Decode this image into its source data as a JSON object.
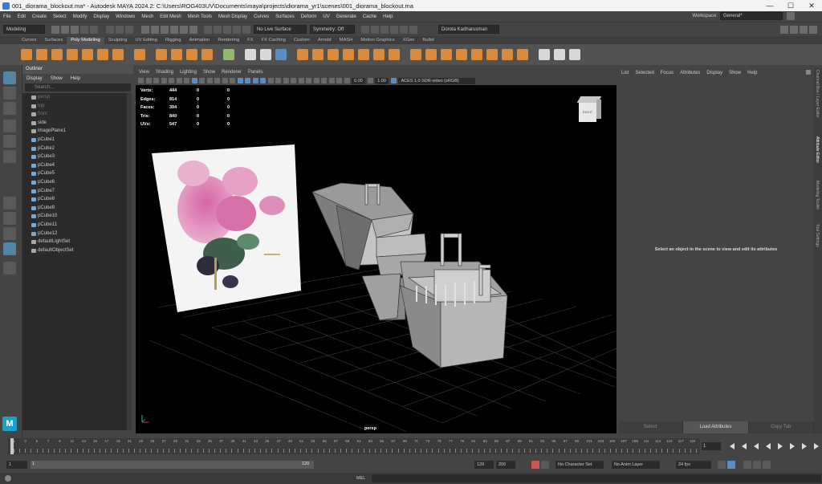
{
  "window": {
    "title": "001_diorama_blockout.ma* - Autodesk MAYA 2024.2: C:\\Users\\ROG403UV\\Documents\\maya\\projects\\diorama_yr1\\scenes\\001_diorama_blockout.ma",
    "minimize": "—",
    "maximize": "☐",
    "close": "✕"
  },
  "menubar": {
    "items": [
      "File",
      "Edit",
      "Create",
      "Select",
      "Modify",
      "Display",
      "Windows",
      "Mesh",
      "Edit Mesh",
      "Mesh Tools",
      "Mesh Display",
      "Curves",
      "Surfaces",
      "Deform",
      "UV",
      "Generate",
      "Cache",
      "Help"
    ],
    "workspace_label": "Workspace:",
    "workspace_value": "General*"
  },
  "statusline": {
    "menuset": "Modeling",
    "live_surface": "No Live Surface",
    "symmetry": "Symmetry: Off",
    "user": "Dorota Kadharusman"
  },
  "shelf_tabs": [
    "Curves",
    "Surfaces",
    "Poly Modeling",
    "Sculpting",
    "UV Editing",
    "Rigging",
    "Animation",
    "Rendering",
    "FX",
    "FX Caching",
    "Custom",
    "Arnold",
    "MASH",
    "Motion Graphics",
    "XGen",
    "Bullet"
  ],
  "shelf_active": "Poly Modeling",
  "outliner": {
    "title": "Outliner",
    "menu": [
      "Display",
      "Show",
      "Help"
    ],
    "search_placeholder": "Search...",
    "items": [
      {
        "label": "persp",
        "dim": true,
        "type": "cam"
      },
      {
        "label": "top",
        "dim": true,
        "type": "cam"
      },
      {
        "label": "front",
        "dim": true,
        "type": "cam"
      },
      {
        "label": "side",
        "dim": false,
        "type": "cam"
      },
      {
        "label": "imagePlane1",
        "dim": false,
        "type": "img"
      },
      {
        "label": "pCube1",
        "dim": false,
        "type": "cube"
      },
      {
        "label": "pCube2",
        "dim": false,
        "type": "cube"
      },
      {
        "label": "pCube3",
        "dim": false,
        "type": "cube"
      },
      {
        "label": "pCube4",
        "dim": false,
        "type": "cube"
      },
      {
        "label": "pCube5",
        "dim": false,
        "type": "cube"
      },
      {
        "label": "pCube6",
        "dim": false,
        "type": "cube"
      },
      {
        "label": "pCube7",
        "dim": false,
        "type": "cube"
      },
      {
        "label": "pCube8",
        "dim": false,
        "type": "cube"
      },
      {
        "label": "pCube9",
        "dim": false,
        "type": "cube"
      },
      {
        "label": "pCube10",
        "dim": false,
        "type": "cube"
      },
      {
        "label": "pCube11",
        "dim": false,
        "type": "cube"
      },
      {
        "label": "pCube12",
        "dim": false,
        "type": "cube"
      },
      {
        "label": "defaultLightSet",
        "dim": false,
        "type": "set"
      },
      {
        "label": "defaultObjectSet",
        "dim": false,
        "type": "set"
      }
    ]
  },
  "viewport": {
    "menu": [
      "View",
      "Shading",
      "Lighting",
      "Show",
      "Renderer",
      "Panels"
    ],
    "exposure": "0.00",
    "gamma": "1.00",
    "colorspace": "ACES 1.0 SDR-video (sRGB)",
    "hud": [
      {
        "label": "Verts:",
        "v1": "444",
        "v2": "0",
        "v3": "0"
      },
      {
        "label": "Edges:",
        "v1": "814",
        "v2": "0",
        "v3": "0"
      },
      {
        "label": "Faces:",
        "v1": "394",
        "v2": "0",
        "v3": "0"
      },
      {
        "label": "Tris:",
        "v1": "840",
        "v2": "0",
        "v3": "0"
      },
      {
        "label": "UVs:",
        "v1": "547",
        "v2": "0",
        "v3": "0"
      }
    ],
    "viewcube": "RIGHT",
    "camera": "persp"
  },
  "attribute_editor": {
    "menu": [
      "List",
      "Selected",
      "Focus",
      "Attributes",
      "Display",
      "Show",
      "Help"
    ],
    "message": "Select an object in the scene to view and edit its attributes",
    "buttons": [
      "Select",
      "Load Attributes",
      "Copy Tab"
    ],
    "side_tabs": [
      "Channel Box / Layer Editor",
      "Attribute Editor",
      "Modeling Toolkit",
      "Tool Settings"
    ]
  },
  "timeslider": {
    "ticks": [
      "1",
      "2",
      "3",
      "4",
      "5",
      "6",
      "7",
      "8",
      "9",
      "10",
      "11",
      "12",
      "13",
      "14",
      "15",
      "16",
      "17",
      "18",
      "19",
      "20",
      "21",
      "22",
      "23",
      "24",
      "25",
      "26",
      "27",
      "28",
      "29",
      "30",
      "31",
      "32",
      "33",
      "34",
      "35",
      "36",
      "37",
      "38",
      "39",
      "40",
      "41",
      "42",
      "43",
      "44",
      "45",
      "46",
      "47",
      "48",
      "49",
      "50",
      "51",
      "52",
      "53",
      "54",
      "55",
      "56",
      "57",
      "58",
      "59",
      "60",
      "61",
      "62",
      "63",
      "64",
      "65",
      "66",
      "67",
      "68",
      "69",
      "70",
      "71",
      "72",
      "73",
      "74",
      "75",
      "76",
      "77",
      "78",
      "79",
      "80",
      "81",
      "82",
      "83",
      "84",
      "85",
      "86",
      "87",
      "88",
      "89",
      "90",
      "91",
      "92",
      "93",
      "94",
      "95",
      "96",
      "97",
      "98",
      "99",
      "100",
      "101",
      "102",
      "103",
      "104",
      "105",
      "106",
      "107",
      "108",
      "109",
      "110",
      "111",
      "112",
      "113",
      "114",
      "115",
      "116",
      "117",
      "118",
      "119",
      "120"
    ],
    "current_frame": "1"
  },
  "range": {
    "start": "1",
    "inner_start": "1",
    "inner_end": "120",
    "end_value": "120",
    "end": "200",
    "character_set": "No Character Set",
    "anim_layer": "No Anim Layer",
    "fps": "24 fps"
  },
  "cmdline": {
    "lang": "MEL"
  }
}
